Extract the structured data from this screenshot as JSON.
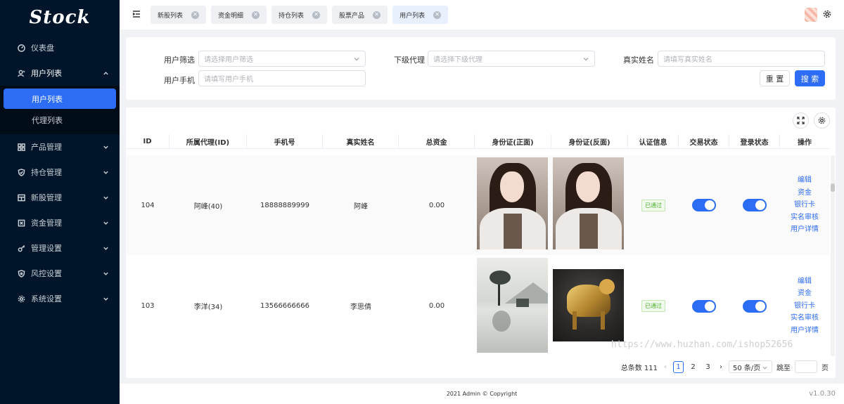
{
  "sidebar": {
    "logo": "Stock",
    "items": [
      {
        "label": "仪表盘"
      },
      {
        "label": "用户列表"
      },
      {
        "label": "产品管理"
      },
      {
        "label": "持仓管理"
      },
      {
        "label": "新股管理"
      },
      {
        "label": "资金管理"
      },
      {
        "label": "管理设置"
      },
      {
        "label": "风控设置"
      },
      {
        "label": "系统设置"
      }
    ],
    "sub_items": [
      {
        "label": "用户列表"
      },
      {
        "label": "代理列表"
      }
    ]
  },
  "header": {
    "tabs": [
      {
        "label": "新股列表"
      },
      {
        "label": "资金明细"
      },
      {
        "label": "持仓列表"
      },
      {
        "label": "股票产品"
      },
      {
        "label": "用户列表"
      }
    ]
  },
  "filter": {
    "user_filter_label": "用户筛选",
    "user_filter_placeholder": "请选择用户筛选",
    "agent_label": "下级代理",
    "agent_placeholder": "请选择下级代理",
    "realname_label": "真实姓名",
    "realname_placeholder": "请填写真实姓名",
    "phone_label": "用户手机",
    "phone_placeholder": "请填写用户手机",
    "reset": "重 置",
    "search": "搜 索"
  },
  "table": {
    "columns": [
      "ID",
      "所属代理(ID)",
      "手机号",
      "真实姓名",
      "总资金",
      "身份证(正面)",
      "身份证(反面)",
      "认证信息",
      "交易状态",
      "登录状态",
      "操作"
    ],
    "rows": [
      {
        "id": "104",
        "agent": "阿峰(40)",
        "phone": "18888889999",
        "name": "阿峰",
        "funds": "0.00",
        "auth": "已通过"
      },
      {
        "id": "103",
        "agent": "李洋(34)",
        "phone": "13566666666",
        "name": "李思倩",
        "funds": "0.00",
        "auth": "已通过"
      }
    ],
    "ops": [
      "编辑",
      "资金",
      "银行卡",
      "实名审核",
      "用户详情"
    ]
  },
  "watermark": "https://www.huzhan.com/ishop52656",
  "pagination": {
    "total": "总条数 111",
    "pages": [
      "1",
      "2",
      "3"
    ],
    "size": "50 条/页",
    "jump": "跳至",
    "page_unit": "页"
  },
  "footer": {
    "copyright": "2021 Admin © Copyright",
    "version": "v1.0.30"
  },
  "colors": {
    "accent": "#2d6cf5",
    "sidebar": "#001529",
    "success": "#4eb12f"
  }
}
